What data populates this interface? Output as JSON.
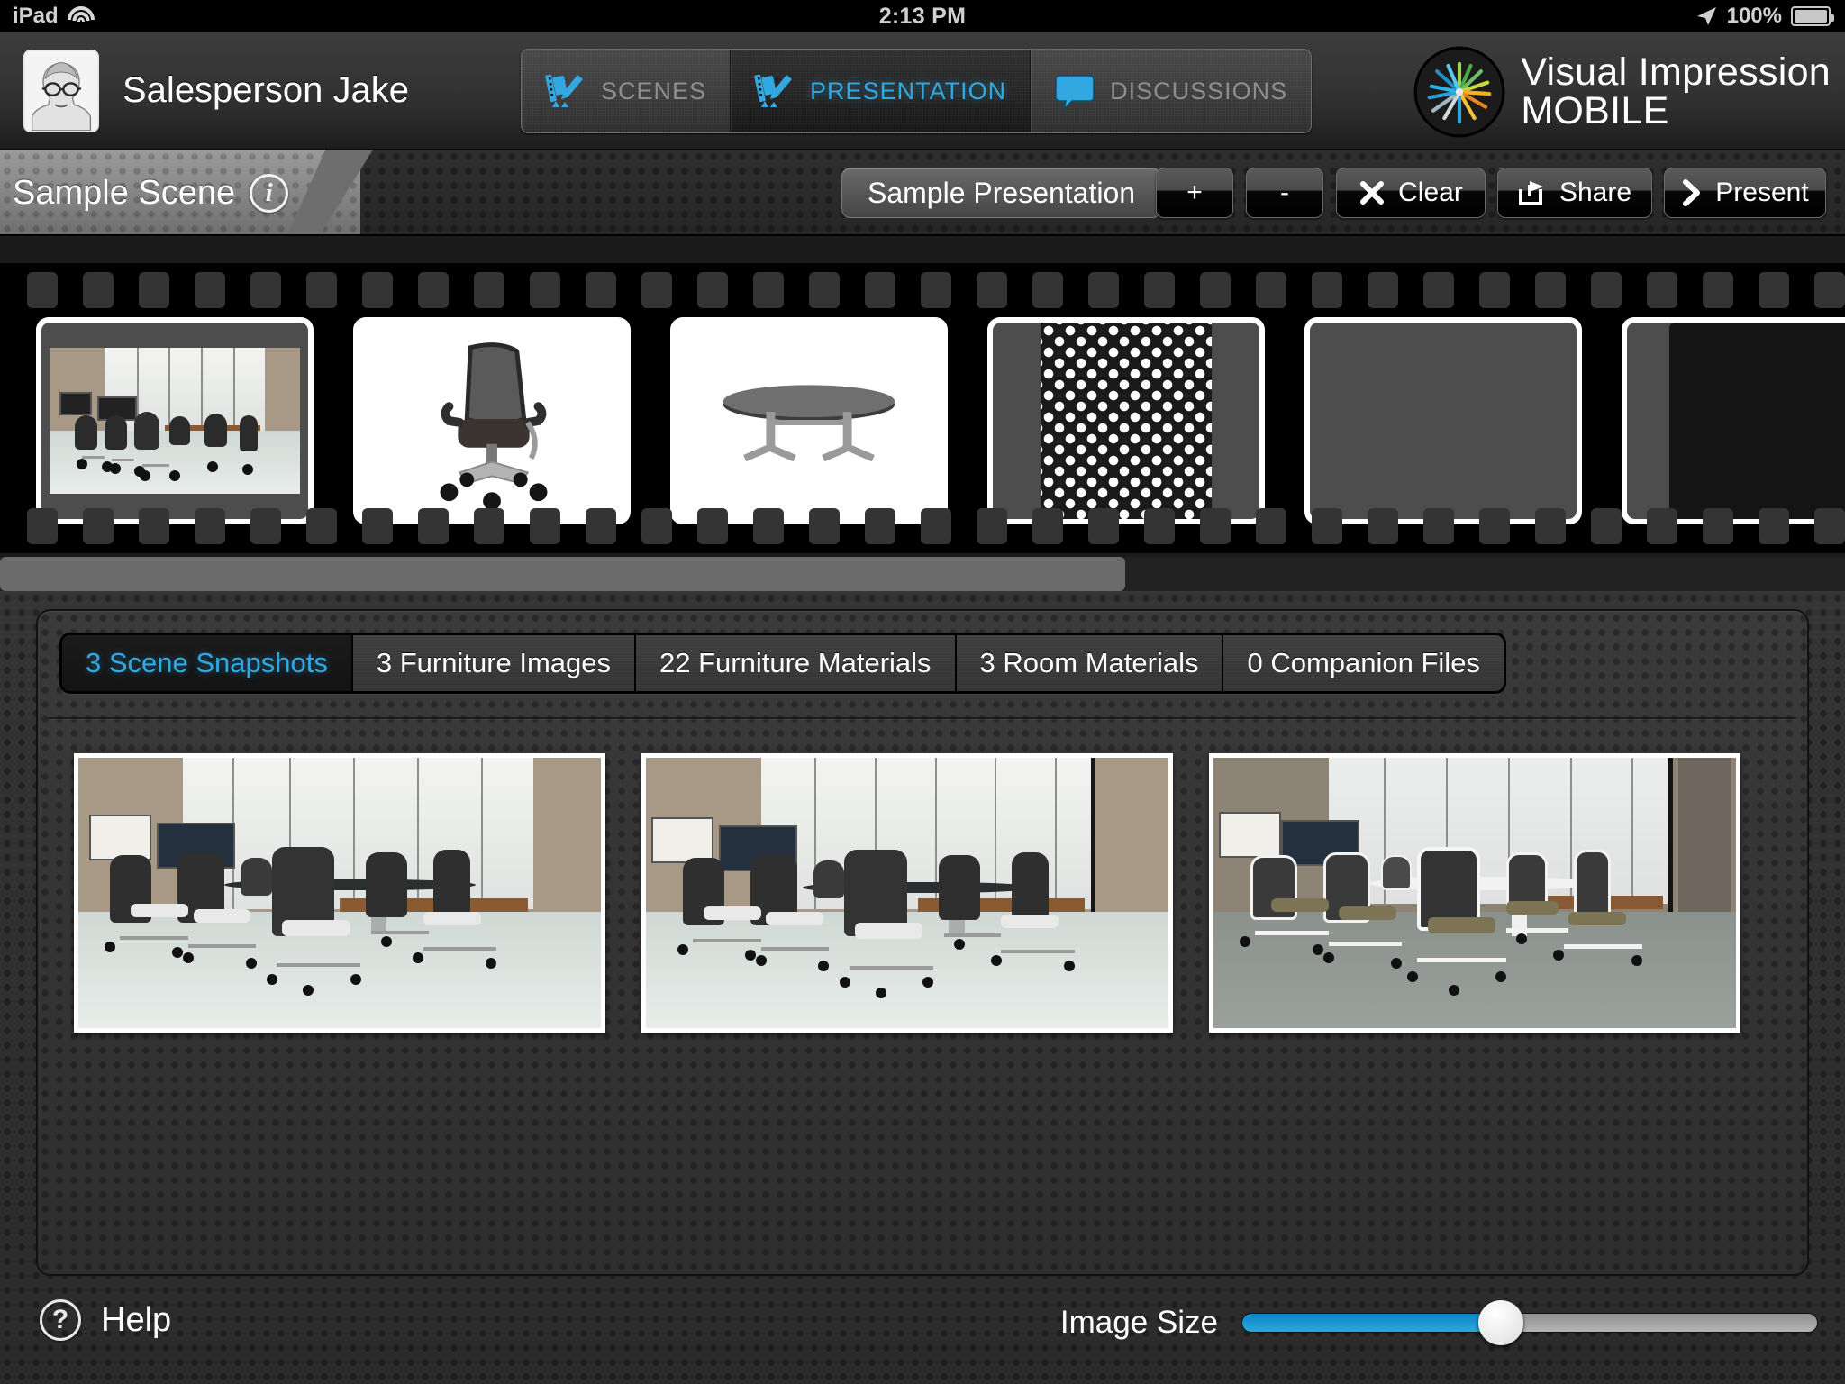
{
  "status_bar": {
    "device": "iPad",
    "wifi_icon": "wifi-icon",
    "time": "2:13 PM",
    "location_icon": "location-arrow-icon",
    "battery_percent": "100%",
    "battery_icon": "battery-icon"
  },
  "header": {
    "avatar_name": "user-avatar",
    "user_name": "Salesperson Jake",
    "nav_tabs": [
      {
        "label": "SCENES",
        "icon": "filmstrip-pencil-icon",
        "active": false
      },
      {
        "label": "PRESENTATION",
        "icon": "filmstrip-pencil-icon",
        "active": true
      },
      {
        "label": "DISCUSSIONS",
        "icon": "speech-bubble-icon",
        "active": false
      }
    ],
    "brand": {
      "logo_icon": "visual-impression-burst-logo",
      "line1": "Visual Impression",
      "line2": "MOBILE"
    }
  },
  "scene_bar": {
    "scene_name": "Sample Scene",
    "info_icon": "info-icon",
    "presentation_name": "Sample Presentation",
    "buttons": [
      {
        "id": "plus",
        "label": "+",
        "icon": ""
      },
      {
        "id": "minus",
        "label": "-",
        "icon": ""
      },
      {
        "id": "clear",
        "label": "Clear",
        "icon": "close-x-icon"
      },
      {
        "id": "share",
        "label": "Share",
        "icon": "share-export-icon"
      },
      {
        "id": "present",
        "label": "Present",
        "icon": "chevron-right-icon"
      }
    ]
  },
  "filmstrip": {
    "items": [
      {
        "name": "conference-room-scene",
        "kind": "scene"
      },
      {
        "name": "task-chair-image",
        "kind": "furniture"
      },
      {
        "name": "conference-table-image",
        "kind": "furniture"
      },
      {
        "name": "dot-pattern-material",
        "kind": "material"
      },
      {
        "name": "brown-texture-material",
        "kind": "material"
      },
      {
        "name": "dark-material",
        "kind": "material"
      }
    ],
    "scrollbar_percent": 61
  },
  "content_tabs": [
    {
      "label": "3 Scene Snapshots",
      "active": true
    },
    {
      "label": "3 Furniture Images",
      "active": false
    },
    {
      "label": "22 Furniture Materials",
      "active": false
    },
    {
      "label": "3 Room Materials",
      "active": false
    },
    {
      "label": "0 Companion Files",
      "active": false
    }
  ],
  "snapshots": [
    {
      "name": "snapshot-1-glossy-floor",
      "variant": "glossy"
    },
    {
      "name": "snapshot-2-glossy-floor",
      "variant": "glossy"
    },
    {
      "name": "snapshot-3-white-frames",
      "variant": "carpet"
    }
  ],
  "footer": {
    "help_icon": "question-mark-icon",
    "help_label": "Help",
    "image_size_label": "Image Size",
    "image_size_percent": 45
  },
  "colors": {
    "accent_blue": "#31a8e0",
    "header_dark": "#343434",
    "panel_dark": "#2e2e2e",
    "slider_blue": "#1e97d2"
  }
}
